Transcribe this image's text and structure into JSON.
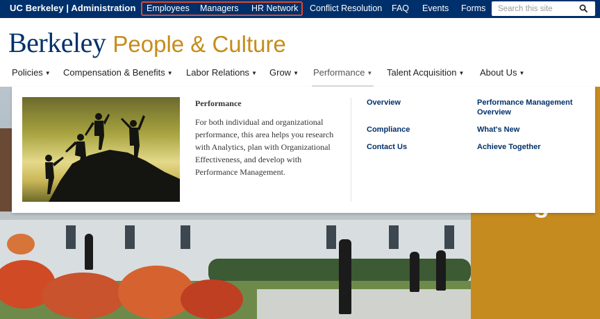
{
  "topbar": {
    "brand": "UC Berkeley | Administration",
    "links": [
      "Employees",
      "Managers",
      "HR Network",
      "Conflict Resolution",
      "FAQ",
      "Events",
      "Forms"
    ],
    "search_placeholder": "Search this site",
    "highlight_color": "#e0492c",
    "background": "#00306b"
  },
  "logo": {
    "primary": "Berkeley",
    "secondary": "People & Culture",
    "primary_color": "#00306b",
    "secondary_color": "#c58c1a"
  },
  "nav": {
    "items": [
      "Policies",
      "Compensation & Benefits",
      "Labor Relations",
      "Grow",
      "Performance",
      "Talent Acquisition",
      "About Us"
    ],
    "active": "Performance"
  },
  "panel": {
    "title": "Performance",
    "description": "For both individual and organizational performance, this area helps you research with Analytics, plan with Organizational Effectiveness, and develop with Performance Management.",
    "col1": [
      "Overview",
      "Compliance",
      "Contact Us"
    ],
    "col2": [
      "Performance Management Overview",
      "What's New",
      "Achieve Together"
    ],
    "link_color": "#00306b"
  },
  "hero": {
    "accent_color": "#c68b1f",
    "partial_text": "g s"
  }
}
